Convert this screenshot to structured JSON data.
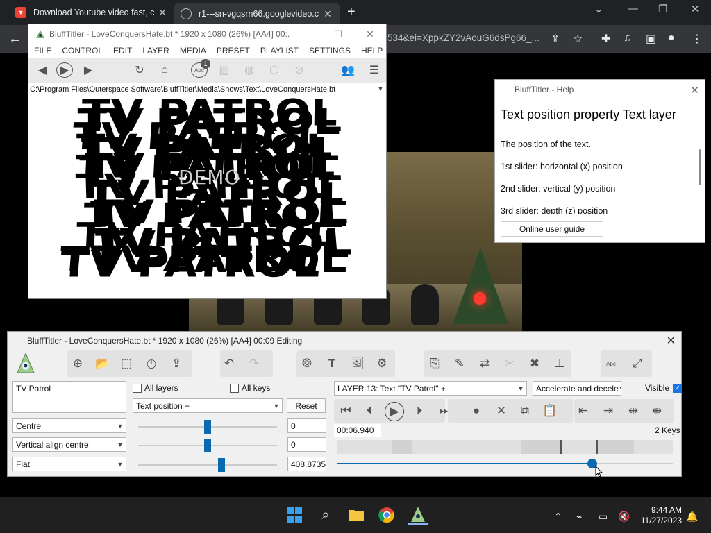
{
  "browser": {
    "tabs": [
      {
        "title": "Download Youtube video fast, c",
        "active": false
      },
      {
        "title": "r1---sn-vgqsrn66.googlevideo.c",
        "active": true
      }
    ],
    "url_tail": "534&ei=XppkZY2vAouG6dsPg66_...",
    "win_controls": {
      "minimize": "—",
      "restore": "❐",
      "close": "✕"
    },
    "toolbar_icons": [
      "share-icon",
      "star-icon",
      "extensions-icon",
      "media-icon",
      "sidepanel-icon",
      "profile-icon",
      "menu-icon"
    ]
  },
  "preview_window": {
    "title": "BluffTitler - LoveConquersHate.bt * 1920 x 1080 (26%) [AA4] 00:...",
    "menu": [
      "FILE",
      "CONTROL",
      "EDIT",
      "LAYER",
      "MEDIA",
      "PRESET",
      "PLAYLIST",
      "SETTINGS",
      "HELP"
    ],
    "abc_badge": "1",
    "path": "C:\\Program Files\\Outerspace Software\\BluffTitler\\Media\\Shows\\Text\\LoveConquersHate.bt",
    "watermark": "DEMO",
    "scramble_text": [
      "TV PATROL"
    ]
  },
  "help": {
    "title": "BluffTitler - Help",
    "heading": "Text position property Text layer",
    "lines": [
      "The position of the text.",
      "1st slider: horizontal (x) position",
      "2nd slider: vertical (y) position",
      "3rd slider: depth (z) position"
    ],
    "button": "Online user guide"
  },
  "editor": {
    "title": "BluffTitler - LoveConquersHate.bt * 1920 x 1080 (26%) [AA4] 00:09 Editing",
    "text_value": "TV Patrol",
    "all_layers_label": "All layers",
    "all_layers_checked": false,
    "all_keys_label": "All keys",
    "all_keys_checked": false,
    "property_select": "Text position +",
    "reset_label": "Reset",
    "layer_select": "LAYER 13: Text \"TV Patrol\" +",
    "easing_select": "Accelerate and decele",
    "visible_label": "Visible",
    "visible_checked": true,
    "align_select": "Centre",
    "valign_select": "Vertical align centre",
    "style_select": "Flat",
    "slider_values": [
      "0",
      "0",
      "408.87359"
    ],
    "slider_positions": [
      0.5,
      0.5,
      0.6
    ],
    "time": "00:06.940",
    "keys_count": "2 Keys",
    "timeline_progress": 0.76
  },
  "taskbar": {
    "apps": [
      "windows-start-icon",
      "search-icon",
      "file-explorer-icon",
      "chrome-icon",
      "blufftitler-icon"
    ],
    "time": "9:44 AM",
    "date": "11/27/2023"
  }
}
